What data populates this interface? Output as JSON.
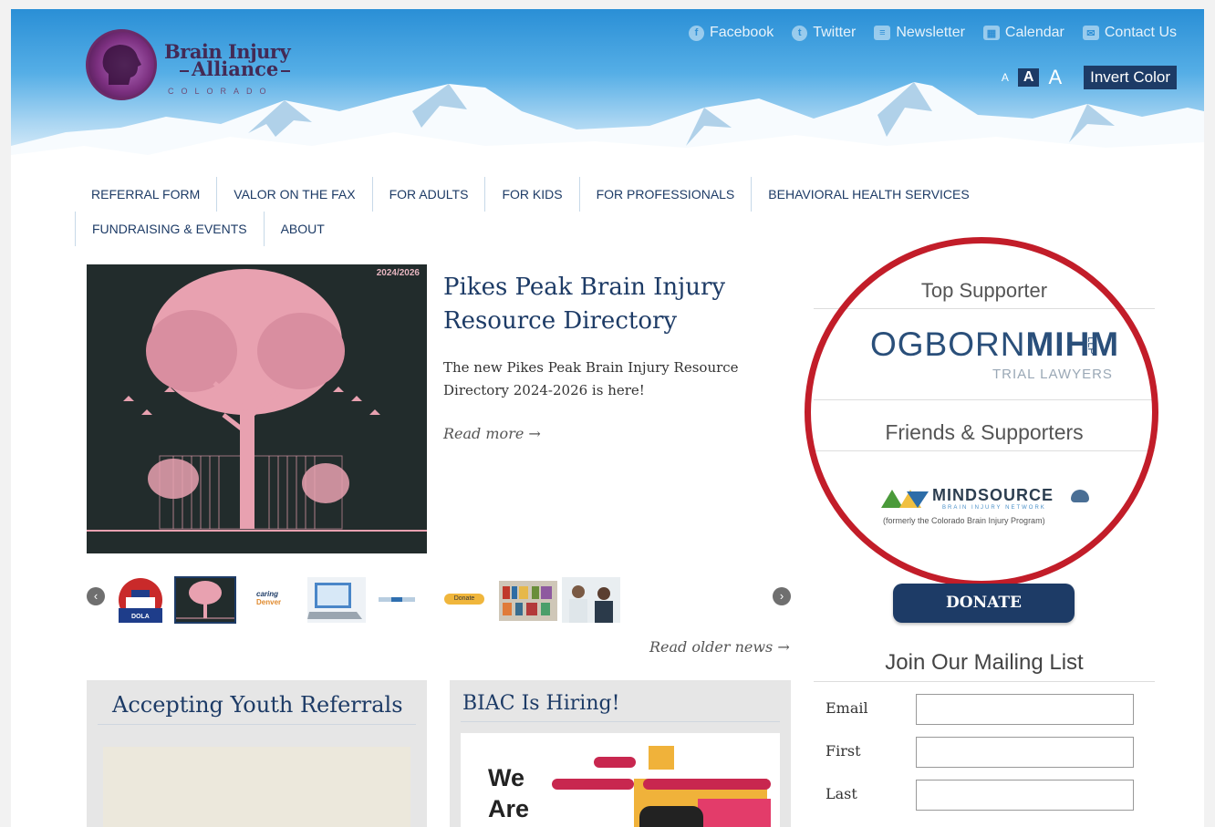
{
  "header": {
    "logo": {
      "line1": "Brain Injury",
      "line2": "Alliance",
      "line3": "COLORADO"
    },
    "social": [
      {
        "label": "Facebook",
        "icon": "facebook-icon"
      },
      {
        "label": "Twitter",
        "icon": "twitter-icon"
      },
      {
        "label": "Newsletter",
        "icon": "newsletter-icon"
      },
      {
        "label": "Calendar",
        "icon": "calendar-icon"
      },
      {
        "label": "Contact Us",
        "icon": "mail-icon"
      }
    ],
    "text_size": {
      "small": "A",
      "medium": "A",
      "large": "A"
    },
    "invert_label": "Invert Color"
  },
  "nav": {
    "row1": [
      "REFERRAL FORM",
      "VALOR ON THE FAX",
      "FOR ADULTS",
      "FOR KIDS",
      "FOR PROFESSIONALS",
      "BEHAVIORAL HEALTH SERVICES"
    ],
    "row2": [
      "FUNDRAISING & EVENTS",
      "ABOUT"
    ]
  },
  "feature": {
    "image_year": "2024/2026",
    "title": "Pikes Peak Brain Injury Resource Directory",
    "body": "The new Pikes Peak Brain Injury Resource Directory 2024-2026 is here!",
    "read_more": "Read more →"
  },
  "carousel": {
    "thumbs": [
      "dola-logo",
      "tree-poster",
      "caring-for-denver-logo",
      "laptop-photo",
      "partner-logo",
      "donate-button-image",
      "bookshelf-photo",
      "clinic-photo"
    ],
    "thumb_texts": {
      "caring": "caring",
      "denver": "Denver",
      "donate": "Donate",
      "dola": "DOLA"
    }
  },
  "read_older": "Read older news →",
  "cards": [
    {
      "title": "Accepting Youth Referrals"
    },
    {
      "title": "BIAC Is Hiring!",
      "image_text": [
        "We",
        "Are"
      ]
    }
  ],
  "sidebar": {
    "top_supporter_title": "Top Supporter",
    "top_supporter_logo": {
      "name1": "OGBORN",
      "name2": "MIHM",
      "suffix": "LLP",
      "tagline": "TRIAL LAWYERS"
    },
    "friends_title": "Friends & Supporters",
    "friend_logo": {
      "name": "MINDSOURCE",
      "sub": "BRAIN INJURY NETWORK",
      "note": "(formerly the Colorado Brain Injury Program)"
    },
    "donate_label": "DONATE",
    "mailing": {
      "title": "Join Our Mailing List",
      "fields": [
        {
          "label": "Email",
          "value": ""
        },
        {
          "label": "First",
          "value": ""
        },
        {
          "label": "Last",
          "value": ""
        }
      ]
    }
  },
  "colors": {
    "navy": "#1d3b66",
    "highlight_circle": "#c21d29",
    "pink": "#e8a1b0"
  }
}
